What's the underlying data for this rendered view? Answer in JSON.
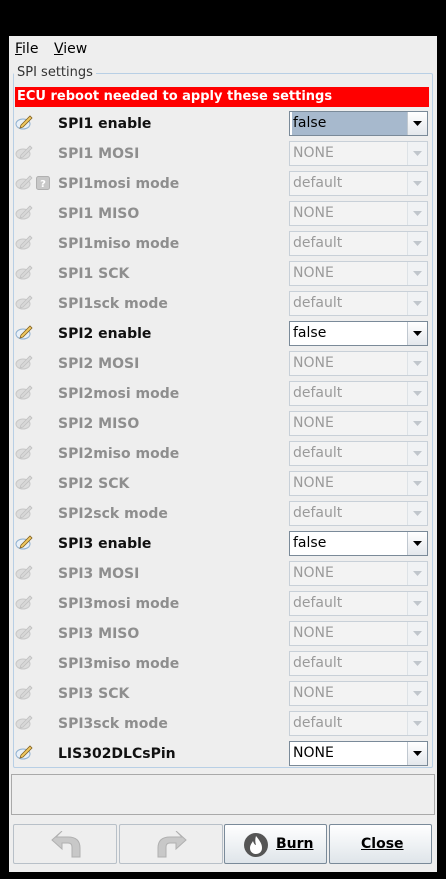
{
  "menu": {
    "file": "File",
    "view": "View"
  },
  "panel": {
    "title": "SPI settings",
    "warning": "ECU reboot needed to apply these settings",
    "rows": [
      {
        "label": "SPI1 enable",
        "value": "false",
        "enabled": true,
        "selected": true
      },
      {
        "label": "SPI1 MOSI",
        "value": "NONE",
        "enabled": false
      },
      {
        "label": "SPI1mosi mode",
        "value": "default",
        "enabled": false,
        "help": true
      },
      {
        "label": "SPI1 MISO",
        "value": "NONE",
        "enabled": false
      },
      {
        "label": "SPI1miso mode",
        "value": "default",
        "enabled": false
      },
      {
        "label": "SPI1 SCK",
        "value": "NONE",
        "enabled": false
      },
      {
        "label": "SPI1sck mode",
        "value": "default",
        "enabled": false
      },
      {
        "label": "SPI2 enable",
        "value": "false",
        "enabled": true
      },
      {
        "label": "SPI2 MOSI",
        "value": "NONE",
        "enabled": false
      },
      {
        "label": "SPI2mosi mode",
        "value": "default",
        "enabled": false
      },
      {
        "label": "SPI2 MISO",
        "value": "NONE",
        "enabled": false
      },
      {
        "label": "SPI2miso mode",
        "value": "default",
        "enabled": false
      },
      {
        "label": "SPI2 SCK",
        "value": "NONE",
        "enabled": false
      },
      {
        "label": "SPI2sck mode",
        "value": "default",
        "enabled": false
      },
      {
        "label": "SPI3 enable",
        "value": "false",
        "enabled": true
      },
      {
        "label": "SPI3 MOSI",
        "value": "NONE",
        "enabled": false
      },
      {
        "label": "SPI3mosi mode",
        "value": "default",
        "enabled": false
      },
      {
        "label": "SPI3 MISO",
        "value": "NONE",
        "enabled": false
      },
      {
        "label": "SPI3miso mode",
        "value": "default",
        "enabled": false
      },
      {
        "label": "SPI3 SCK",
        "value": "NONE",
        "enabled": false
      },
      {
        "label": "SPI3sck mode",
        "value": "default",
        "enabled": false
      },
      {
        "label": "LIS302DLCsPin",
        "value": "NONE",
        "enabled": true
      }
    ]
  },
  "buttons": {
    "burn": "Burn",
    "close": "Close"
  },
  "colors": {
    "warning_bg": "#ff0000",
    "selected_bg": "#a7b9cd",
    "disabled_text": "#8e8e8e"
  }
}
